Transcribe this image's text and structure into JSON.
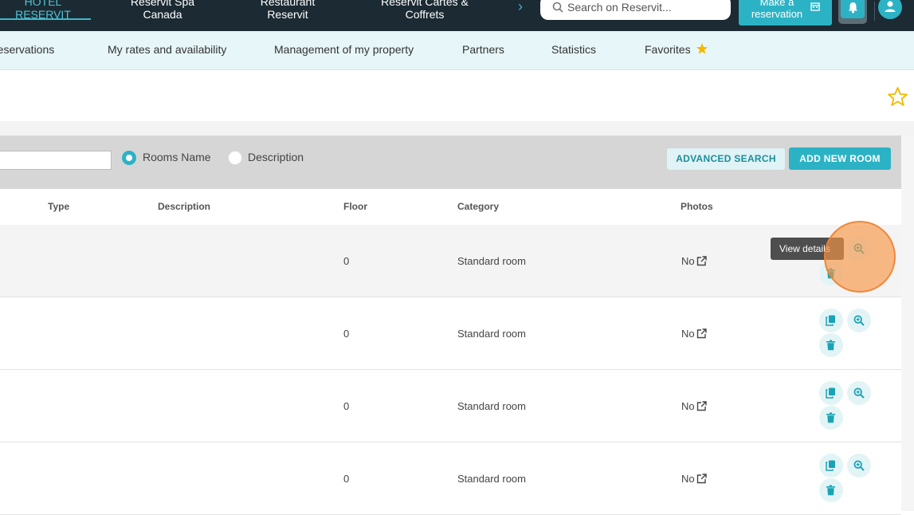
{
  "topbar": {
    "tabs": [
      {
        "label": "HOTEL\nRESERVIT",
        "active": true
      },
      {
        "label": "Reservit Spa\nCanada",
        "active": false
      },
      {
        "label": "Restaurant\nReservit",
        "active": false
      },
      {
        "label": "Reservit Cartes &\nCoffrets",
        "active": false
      }
    ],
    "search_placeholder": "Search on Reservit...",
    "make_reservation_label": "Make a reservation",
    "icons": [
      "chevron-right-icon",
      "search-icon",
      "calendar-icon",
      "bell-icon",
      "user-icon"
    ]
  },
  "nav": {
    "items": [
      "reservations",
      "My rates and availability",
      "Management of my property",
      "Partners",
      "Statistics",
      "Favorites"
    ]
  },
  "filters": {
    "search_value": "",
    "radio_rooms_name": "Rooms Name",
    "radio_description": "Description",
    "selected": "Rooms Name",
    "advanced_search_label": "ADVANCED SEARCH",
    "add_new_room_label": "ADD NEW ROOM"
  },
  "table": {
    "headers": [
      "Type",
      "Description",
      "Floor",
      "Category",
      "Photos"
    ],
    "rows": [
      {
        "type": "",
        "description": "",
        "floor": "0",
        "category": "Standard room",
        "photos": "No"
      },
      {
        "type": "",
        "description": "",
        "floor": "0",
        "category": "Standard room",
        "photos": "No"
      },
      {
        "type": "",
        "description": "",
        "floor": "0",
        "category": "Standard room",
        "photos": "No"
      },
      {
        "type": "",
        "description": "",
        "floor": "0",
        "category": "Standard room",
        "photos": "No"
      }
    ]
  },
  "tooltip": "View details",
  "colors": {
    "topbar_bg": "#1b2a33",
    "accent": "#2bb3c5",
    "nav_bg": "#e7f6f8",
    "star": "#f5b800",
    "highlight": "#f79646"
  }
}
